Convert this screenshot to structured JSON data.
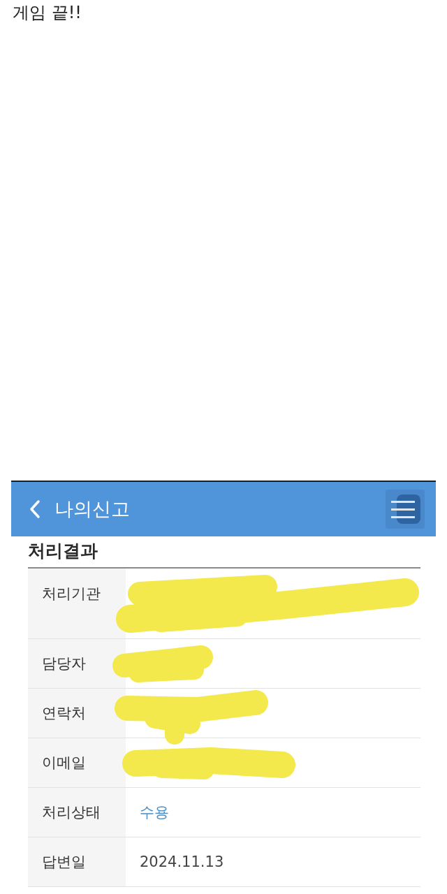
{
  "post": {
    "text": "게임 끝!!"
  },
  "screenshot": {
    "header": {
      "title": "나의신고"
    },
    "section_title": "처리결과",
    "rows": [
      {
        "label": "처리기관",
        "kind": "redacted"
      },
      {
        "label": "담당자",
        "kind": "redacted"
      },
      {
        "label": "연락처",
        "kind": "redacted"
      },
      {
        "label": "이메일",
        "kind": "redacted"
      },
      {
        "label": "처리상태",
        "kind": "status",
        "value": "수용"
      },
      {
        "label": "답변일",
        "kind": "text",
        "value": "2024.11.13"
      }
    ]
  }
}
